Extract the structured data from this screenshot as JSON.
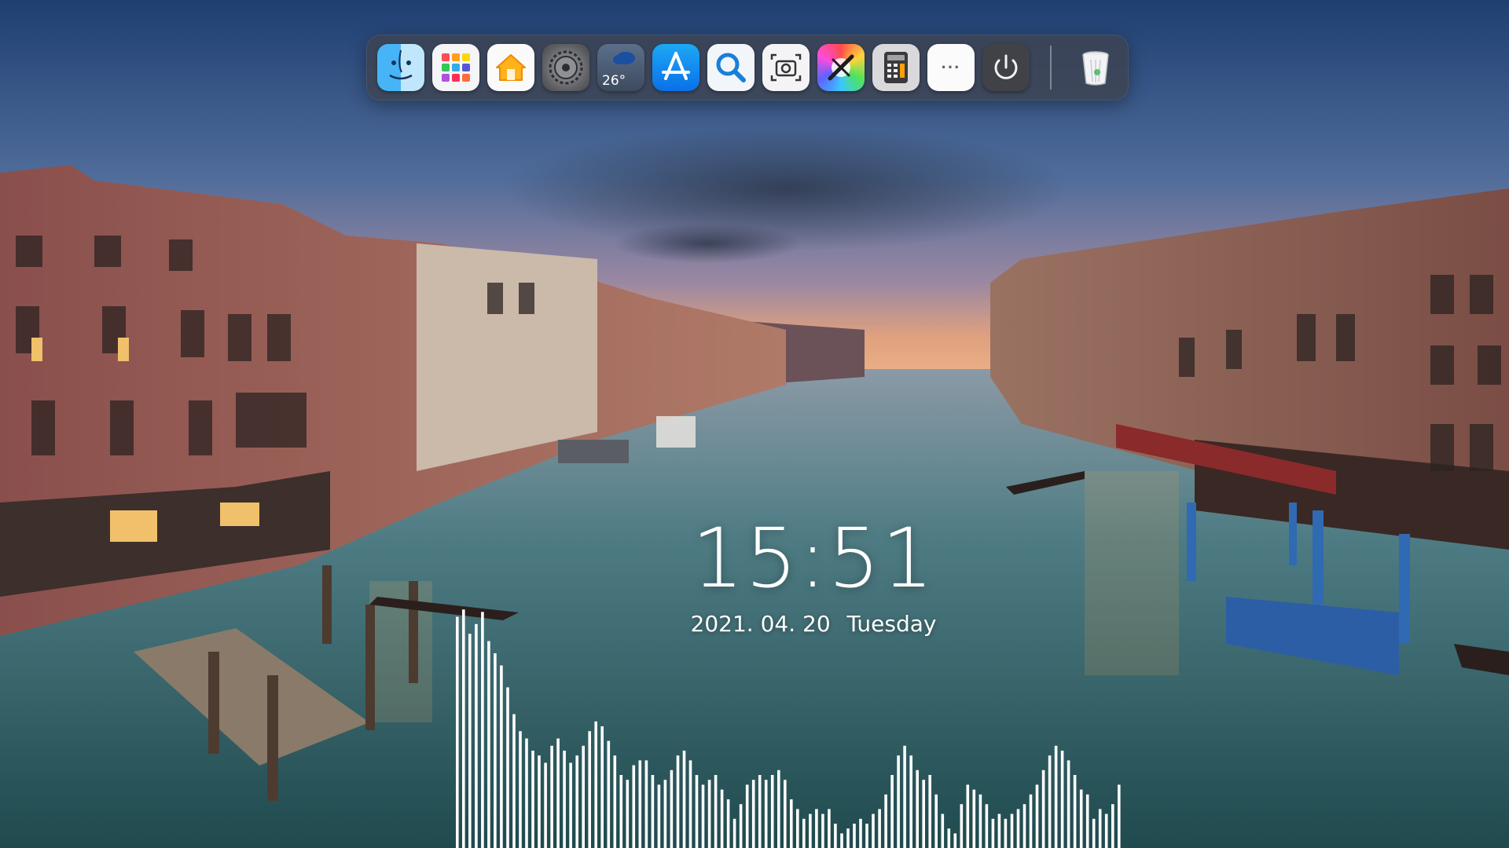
{
  "colors": {
    "dock_background": "#3e4250",
    "clock_text": "#ffffff",
    "visualizer_bar": "#ffffff"
  },
  "dock": {
    "items": [
      {
        "name": "finder",
        "icon": "finder-icon"
      },
      {
        "name": "launchpad",
        "icon": "launchpad-grid-icon"
      },
      {
        "name": "home",
        "icon": "home-icon"
      },
      {
        "name": "system-settings",
        "icon": "gear-icon"
      },
      {
        "name": "weather",
        "icon": "cloud-icon",
        "label": "26°"
      },
      {
        "name": "app-store",
        "icon": "app-store-icon"
      },
      {
        "name": "search",
        "icon": "magnifier-icon"
      },
      {
        "name": "screenshot",
        "icon": "camera-icon"
      },
      {
        "name": "color-picker",
        "icon": "color-wheel-icon"
      },
      {
        "name": "calculator",
        "icon": "calculator-icon"
      },
      {
        "name": "more",
        "icon": "more-dots-icon",
        "label": "···"
      },
      {
        "name": "power",
        "icon": "power-icon"
      },
      {
        "name": "trash",
        "icon": "trash-icon"
      }
    ]
  },
  "clock": {
    "time": "15:51",
    "date": "2021. 04. 20",
    "weekday": "Tuesday"
  },
  "visualizer": {
    "levels": [
      0.95,
      0.98,
      0.88,
      0.92,
      0.97,
      0.85,
      0.8,
      0.75,
      0.66,
      0.55,
      0.48,
      0.45,
      0.4,
      0.38,
      0.35,
      0.42,
      0.45,
      0.4,
      0.35,
      0.38,
      0.42,
      0.48,
      0.52,
      0.5,
      0.44,
      0.38,
      0.3,
      0.28,
      0.34,
      0.36,
      0.36,
      0.3,
      0.26,
      0.28,
      0.32,
      0.38,
      0.4,
      0.36,
      0.3,
      0.26,
      0.28,
      0.3,
      0.24,
      0.2,
      0.12,
      0.18,
      0.26,
      0.28,
      0.3,
      0.28,
      0.3,
      0.32,
      0.28,
      0.2,
      0.16,
      0.12,
      0.14,
      0.16,
      0.14,
      0.16,
      0.1,
      0.06,
      0.08,
      0.1,
      0.12,
      0.1,
      0.14,
      0.16,
      0.22,
      0.3,
      0.38,
      0.42,
      0.38,
      0.32,
      0.28,
      0.3,
      0.22,
      0.14,
      0.08,
      0.06,
      0.18,
      0.26,
      0.24,
      0.22,
      0.18,
      0.12,
      0.14,
      0.12,
      0.14,
      0.16,
      0.18,
      0.22,
      0.26,
      0.32,
      0.38,
      0.42,
      0.4,
      0.36,
      0.3,
      0.24,
      0.22,
      0.12,
      0.16,
      0.14,
      0.18,
      0.26
    ]
  }
}
